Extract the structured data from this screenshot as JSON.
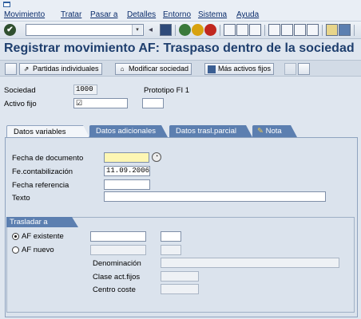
{
  "menu": [
    "Movimiento",
    "Tratar",
    "Pasar a",
    "Detalles",
    "Entorno",
    "Sistema",
    "Ayuda"
  ],
  "title": "Registrar movimiento AF: Traspaso dentro de la sociedad",
  "app_toolbar": {
    "partidas": "Partidas individuales",
    "modificar": "Modificar sociedad",
    "mas_activos": "Más activos fijos"
  },
  "header": {
    "sociedad_label": "Sociedad",
    "sociedad_value": "1000",
    "sociedad_desc": "Prototipo FI 1",
    "activo_label": "Activo fijo",
    "activo_value": "☑"
  },
  "tabs": [
    "Datos variables",
    "Datos adicionales",
    "Datos trasl.parcial",
    "Nota"
  ],
  "form": {
    "fecha_doc_label": "Fecha de documento",
    "fecha_doc_value": "",
    "fe_cont_label": "Fe.contabilización",
    "fe_cont_value": "11.09.2006",
    "fecha_ref_label": "Fecha referencia",
    "fecha_ref_value": "",
    "texto_label": "Texto",
    "texto_value": ""
  },
  "trasladar": {
    "group_label": "Trasladar a",
    "af_existente": "AF existente",
    "af_nuevo": "AF nuevo",
    "denominacion": "Denominación",
    "clase": "Clase act.fijos",
    "centro": "Centro coste",
    "selected": "AF existente"
  },
  "colors": {
    "tab_blue": "#5c7fb0",
    "title_blue": "#1f3f6e",
    "required_field": "#fdf6b3"
  }
}
